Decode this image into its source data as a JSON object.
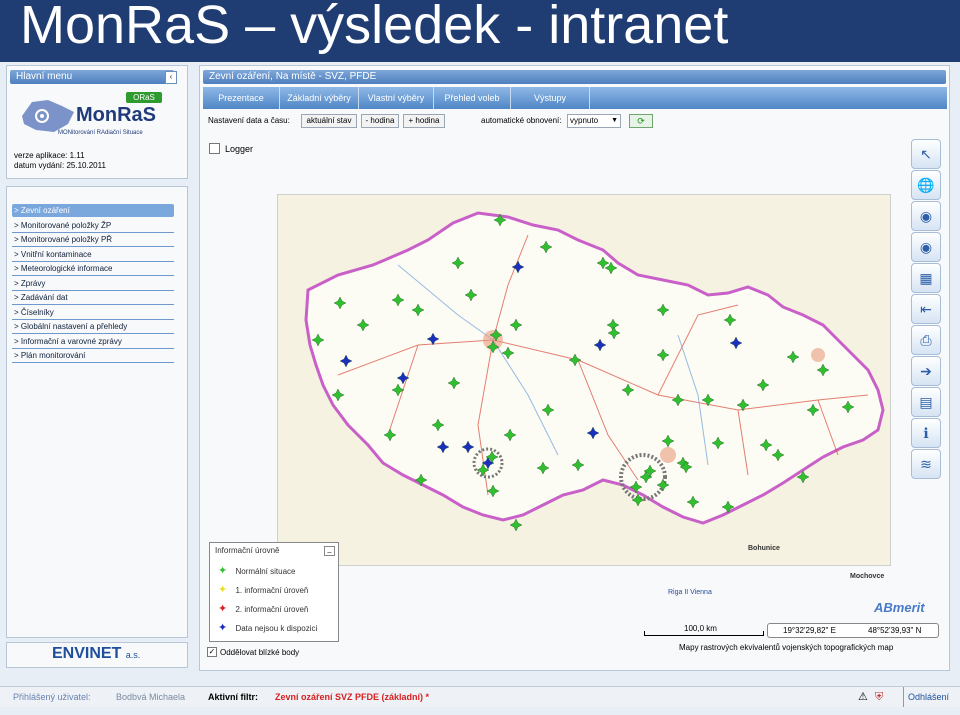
{
  "slide_title": "MonRaS – výsledek - intranet",
  "sidebar": {
    "header": "Hlavní menu",
    "logo_badge": "ORaS",
    "logo_name": "MonRaS",
    "logo_sub": "MONitorování RAdiační Situace",
    "version_label": "verze aplikace: 1.11",
    "date_label": "datum vydání: 25.10.2011",
    "items": [
      {
        "label": "> Zevní ozáření"
      },
      {
        "label": "> Monitorované položky ŽP"
      },
      {
        "label": "> Monitorované položky PŘ"
      },
      {
        "label": "> Vnitřní kontaminace"
      },
      {
        "label": "> Meteorologické informace"
      },
      {
        "label": "> Zprávy"
      },
      {
        "label": "> Zadávání dat"
      },
      {
        "label": "> Číselníky"
      },
      {
        "label": "> Globální nastavení a přehledy"
      },
      {
        "label": "> Informační a varovné zprávy"
      },
      {
        "label": "> Plán monitorování"
      }
    ],
    "footer_brand": "ENVINET",
    "footer_suffix": "a.s."
  },
  "main": {
    "header": "Zevní ozáření, Na místě - SVZ, PFDE",
    "tabs": [
      {
        "label": "Prezentace"
      },
      {
        "label": "Základní výběry"
      },
      {
        "label": "Vlastní výběry"
      },
      {
        "label": "Přehled voleb"
      },
      {
        "label": "Výstupy"
      }
    ],
    "time_label": "Nastavení data a času:",
    "btn_current": "aktuální stav",
    "btn_minus": "- hodina",
    "btn_plus": "+ hodina",
    "refresh_label": "automatické obnovení:",
    "refresh_value": "vypnuto",
    "logger_label": "Logger",
    "separate_label": "Oddělovat blízké body",
    "scale_label": "100,0 km",
    "coord_lon": "19°32'29,82\" E",
    "coord_lat": "48°52'39,93\" N",
    "map_caption": "Mapy rastrových ekvivalentů vojenských topografických map",
    "map_places": [
      "Bohunice",
      "Mochovce",
      "Riga II Vienna"
    ],
    "brand_corner": "ABmerit"
  },
  "legend": {
    "title": "Informační úrovně",
    "items": [
      {
        "label": "Normální situace",
        "color": "#2fbf2f"
      },
      {
        "label": "1. informační úroveň",
        "color": "#e8e020"
      },
      {
        "label": "2. informační úroveň",
        "color": "#d82020"
      },
      {
        "label": "Data nejsou k dispozici",
        "color": "#1a2fc0"
      }
    ]
  },
  "status": {
    "user_label": "Přihlášený uživatel:",
    "user_value": "Bodbvá Michaela",
    "filter_label": "Aktivní filtr:",
    "filter_value": "Zevní ozáření SVZ PFDE (základní) *",
    "logout": "Odhlášení"
  },
  "toolbar_icons": [
    "pointer-icon",
    "globe-icon",
    "sdu-icon",
    "ste-icon",
    "layout-icon",
    "ruler-icon",
    "print-icon",
    "export-icon",
    "page-icon",
    "info-icon",
    "layers-icon"
  ]
}
